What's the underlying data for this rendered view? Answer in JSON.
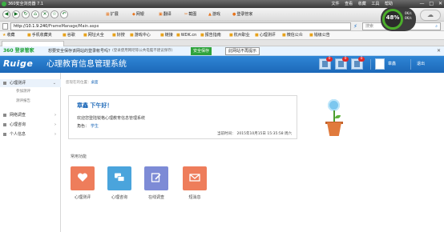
{
  "browser": {
    "title": "360安全浏览器 7.1",
    "menu": [
      "文件",
      "查看",
      "收藏",
      "工具",
      "帮助"
    ],
    "win_controls": [
      "—",
      "□",
      "✕"
    ],
    "toolbar_items": [
      "扩展",
      "网银",
      "翻译",
      "截图",
      "游戏",
      "登录管家"
    ],
    "address": "http://10.1.9.240/FrameManage/Main.aspx",
    "address_host": "http://10.1.9.240",
    "address_path": "/FrameManage/Main.aspx",
    "search_placeholder": "搜索",
    "gauge_percent": "48%",
    "gauge_speed_up": "0K/s",
    "gauge_speed_down": "0K/s",
    "favorites": [
      "收藏",
      "手机收藏夹",
      "谷歌",
      "网址大全",
      "好搜",
      "游戏中心",
      "链接",
      "WDK.cn",
      "报告指南",
      "杭州职业",
      "心理测评",
      "微信公众",
      "钱级公告"
    ]
  },
  "notice": {
    "brand": "360 登录管家",
    "message": "想要安全保存该网站的登录帐号吗？",
    "sub": "(登录使用网吧等公共电脑不建议保存)",
    "save_label": "安全保存",
    "deny_label": "此网站不再提示"
  },
  "app": {
    "logo_text": "Ruige",
    "system_name": "心理教育信息管理系统",
    "badges": [
      "0",
      "0",
      "0"
    ],
    "user_name": "章鑫",
    "exit_label": "退出"
  },
  "sidebar": {
    "groups": [
      {
        "label": "心理测评",
        "active": true,
        "subs": [
          "参加测评",
          "测评报告"
        ]
      },
      {
        "label": "网络调查",
        "active": false,
        "subs": []
      },
      {
        "label": "心理咨询",
        "active": false,
        "subs": []
      },
      {
        "label": "个人信息",
        "active": false,
        "subs": []
      }
    ]
  },
  "breadcrumb": {
    "prefix": "您现在的位置：",
    "current": "桌面"
  },
  "greeting": {
    "hello": "章鑫 下午好！",
    "welcome": "欢迎您登陆锐格心理教育信息管理系统",
    "role_label": "角色：",
    "role_value": "学生",
    "time_label": "当前时间：",
    "time_value": "2015年10月15日 15:35:58 周六"
  },
  "common": {
    "title": "常用功能",
    "tiles": [
      {
        "label": "心理测评",
        "icon": "heart-icon",
        "color": "#ee7d5b"
      },
      {
        "label": "心理咨询",
        "icon": "chat-icon",
        "color": "#4aa4dc"
      },
      {
        "label": "在线调查",
        "icon": "edit-icon",
        "color": "#7d8bd6"
      },
      {
        "label": "短消息",
        "icon": "mail-icon",
        "color": "#ee7d5b"
      }
    ]
  }
}
